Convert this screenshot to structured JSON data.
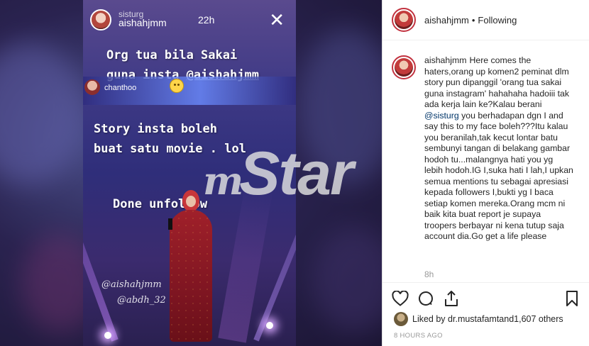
{
  "story": {
    "ghost_username": "sisturg",
    "username": "aishahjmm",
    "time": "22h",
    "close_glyph": "✕",
    "line1": "Org tua bila Sakai",
    "line2_prefix": "guna insta ",
    "line2_mention": "@aishahjmm",
    "band_name": "chanthoo",
    "line3": "Story insta boleh",
    "line4": "buat satu movie . lol",
    "line5": "Done unfollow",
    "sticker1": "@aishahjmm",
    "sticker2": "@abdh_32"
  },
  "watermark": {
    "m": "m",
    "star": "Star"
  },
  "post": {
    "header": {
      "username": "aishahjmm",
      "dot": "•",
      "follow": "Following"
    },
    "comment": {
      "username": "aishahjmm",
      "text_before_mention": "Here comes the haters,orang up komen2 peminat dlm story pun dipanggil 'orang tua sakai guna instagram' hahahaha hadoiii tak ada kerja lain ke?Kalau berani ",
      "mention": "@sisturg",
      "text_after_mention": " you berhadapan dgn I and say this to my face boleh???Itu kalau you beranilah,tak kecut lontar batu sembunyi tangan di belakang gambar hodoh tu...malangnya hati you yg lebih hodoh.IG I,suka hati I lah,I upkan semua mentions tu sebagai apresiasi kepada followers I,bukti yg I baca setiap komen mereka.Orang mcm ni baik kita buat report je supaya troopers berbayar ni kena tutup saja account dia.Go get a life please",
      "time": "8h"
    },
    "actions": [
      "heart-icon",
      "comment-icon",
      "share-icon",
      "bookmark-icon"
    ],
    "likes": {
      "prefix": "Liked by ",
      "liker": "dr.mustafamt",
      "middle": " and ",
      "count": "1,607 others"
    },
    "ago": "8 HOURS AGO"
  }
}
